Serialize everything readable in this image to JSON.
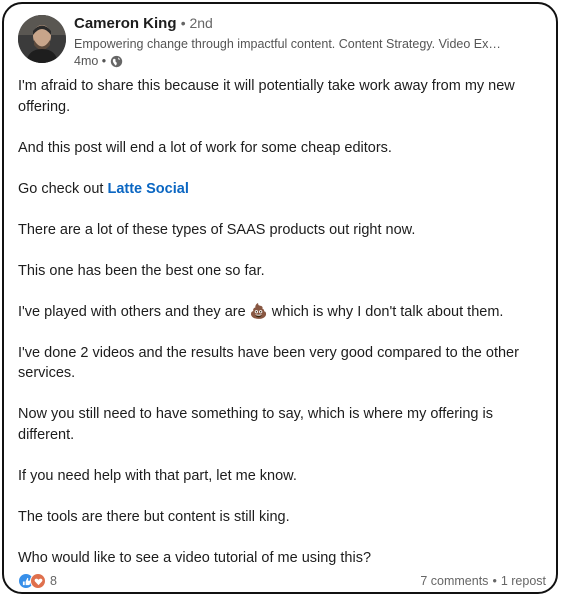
{
  "author": {
    "name": "Cameron King",
    "degree": "• 2nd",
    "headline": "Empowering change through impactful content. Content Strategy. Video Ex…",
    "time": "4mo •"
  },
  "post": {
    "p1": "I'm afraid to share this because it will potentially take work away from my new offering.",
    "p2": "And this post will end a lot of work for some cheap editors.",
    "p3_prefix": "Go check out ",
    "p3_link": "Latte Social",
    "p4": "There are a lot of these types of SAAS products out right now.",
    "p5": "This one has been the best one so far.",
    "p6_prefix": "I've played with others and they are ",
    "p6_emoji": "💩",
    "p6_suffix": " which is why I don't talk about them.",
    "p7": "I've done 2 videos and the results have been very good compared to the other services.",
    "p8": "Now you still need to have something to say, which is where my offering is different.",
    "p9": "If you need help with that part, let me know.",
    "p10": "The tools are there but content is still king.",
    "p11": "Who would like to see a video tutorial of me using this?"
  },
  "footer": {
    "reaction_count": "8",
    "comments": "7 comments",
    "separator": "•",
    "reposts": "1 repost"
  },
  "colors": {
    "link": "#0a66c2",
    "like": "#378fe9",
    "love": "#df704d"
  },
  "icons": [
    "globe-icon",
    "like-reaction-icon",
    "love-reaction-icon",
    "poop-emoji"
  ]
}
